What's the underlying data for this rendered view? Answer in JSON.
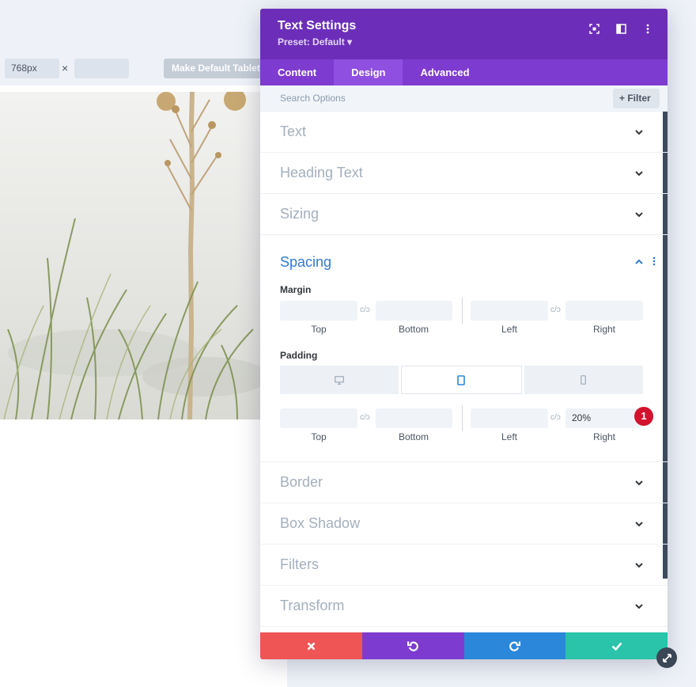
{
  "toolbar": {
    "width_value": "768px",
    "times_symbol": "×",
    "height_value": "",
    "make_default_label": "Make Default Tablet V"
  },
  "modal": {
    "title": "Text Settings",
    "preset": "Preset: Default ▾",
    "tabs": [
      {
        "label": "Content",
        "active": false
      },
      {
        "label": "Design",
        "active": true
      },
      {
        "label": "Advanced",
        "active": false
      }
    ],
    "search_placeholder": "Search Options",
    "filter_label": "+ Filter",
    "sections_top": [
      "Text",
      "Heading Text",
      "Sizing"
    ],
    "spacing": {
      "title": "Spacing",
      "margin_label": "Margin",
      "padding_label": "Padding",
      "field_labels": [
        "Top",
        "Bottom",
        "Left",
        "Right"
      ],
      "margin_values": [
        "",
        "",
        "",
        ""
      ],
      "padding_values": [
        "",
        "",
        "",
        "20%"
      ],
      "active_device": "tablet"
    },
    "sections_bottom": [
      "Border",
      "Box Shadow",
      "Filters",
      "Transform"
    ],
    "badge_number": "1"
  },
  "colors": {
    "header": "#6c2eb9",
    "tabs": "#7e3bd0",
    "accent_blue": "#2f7bd4",
    "cancel": "#ef5555",
    "undo": "#7e3bd0",
    "redo": "#2b87da",
    "save": "#29c4a9"
  }
}
